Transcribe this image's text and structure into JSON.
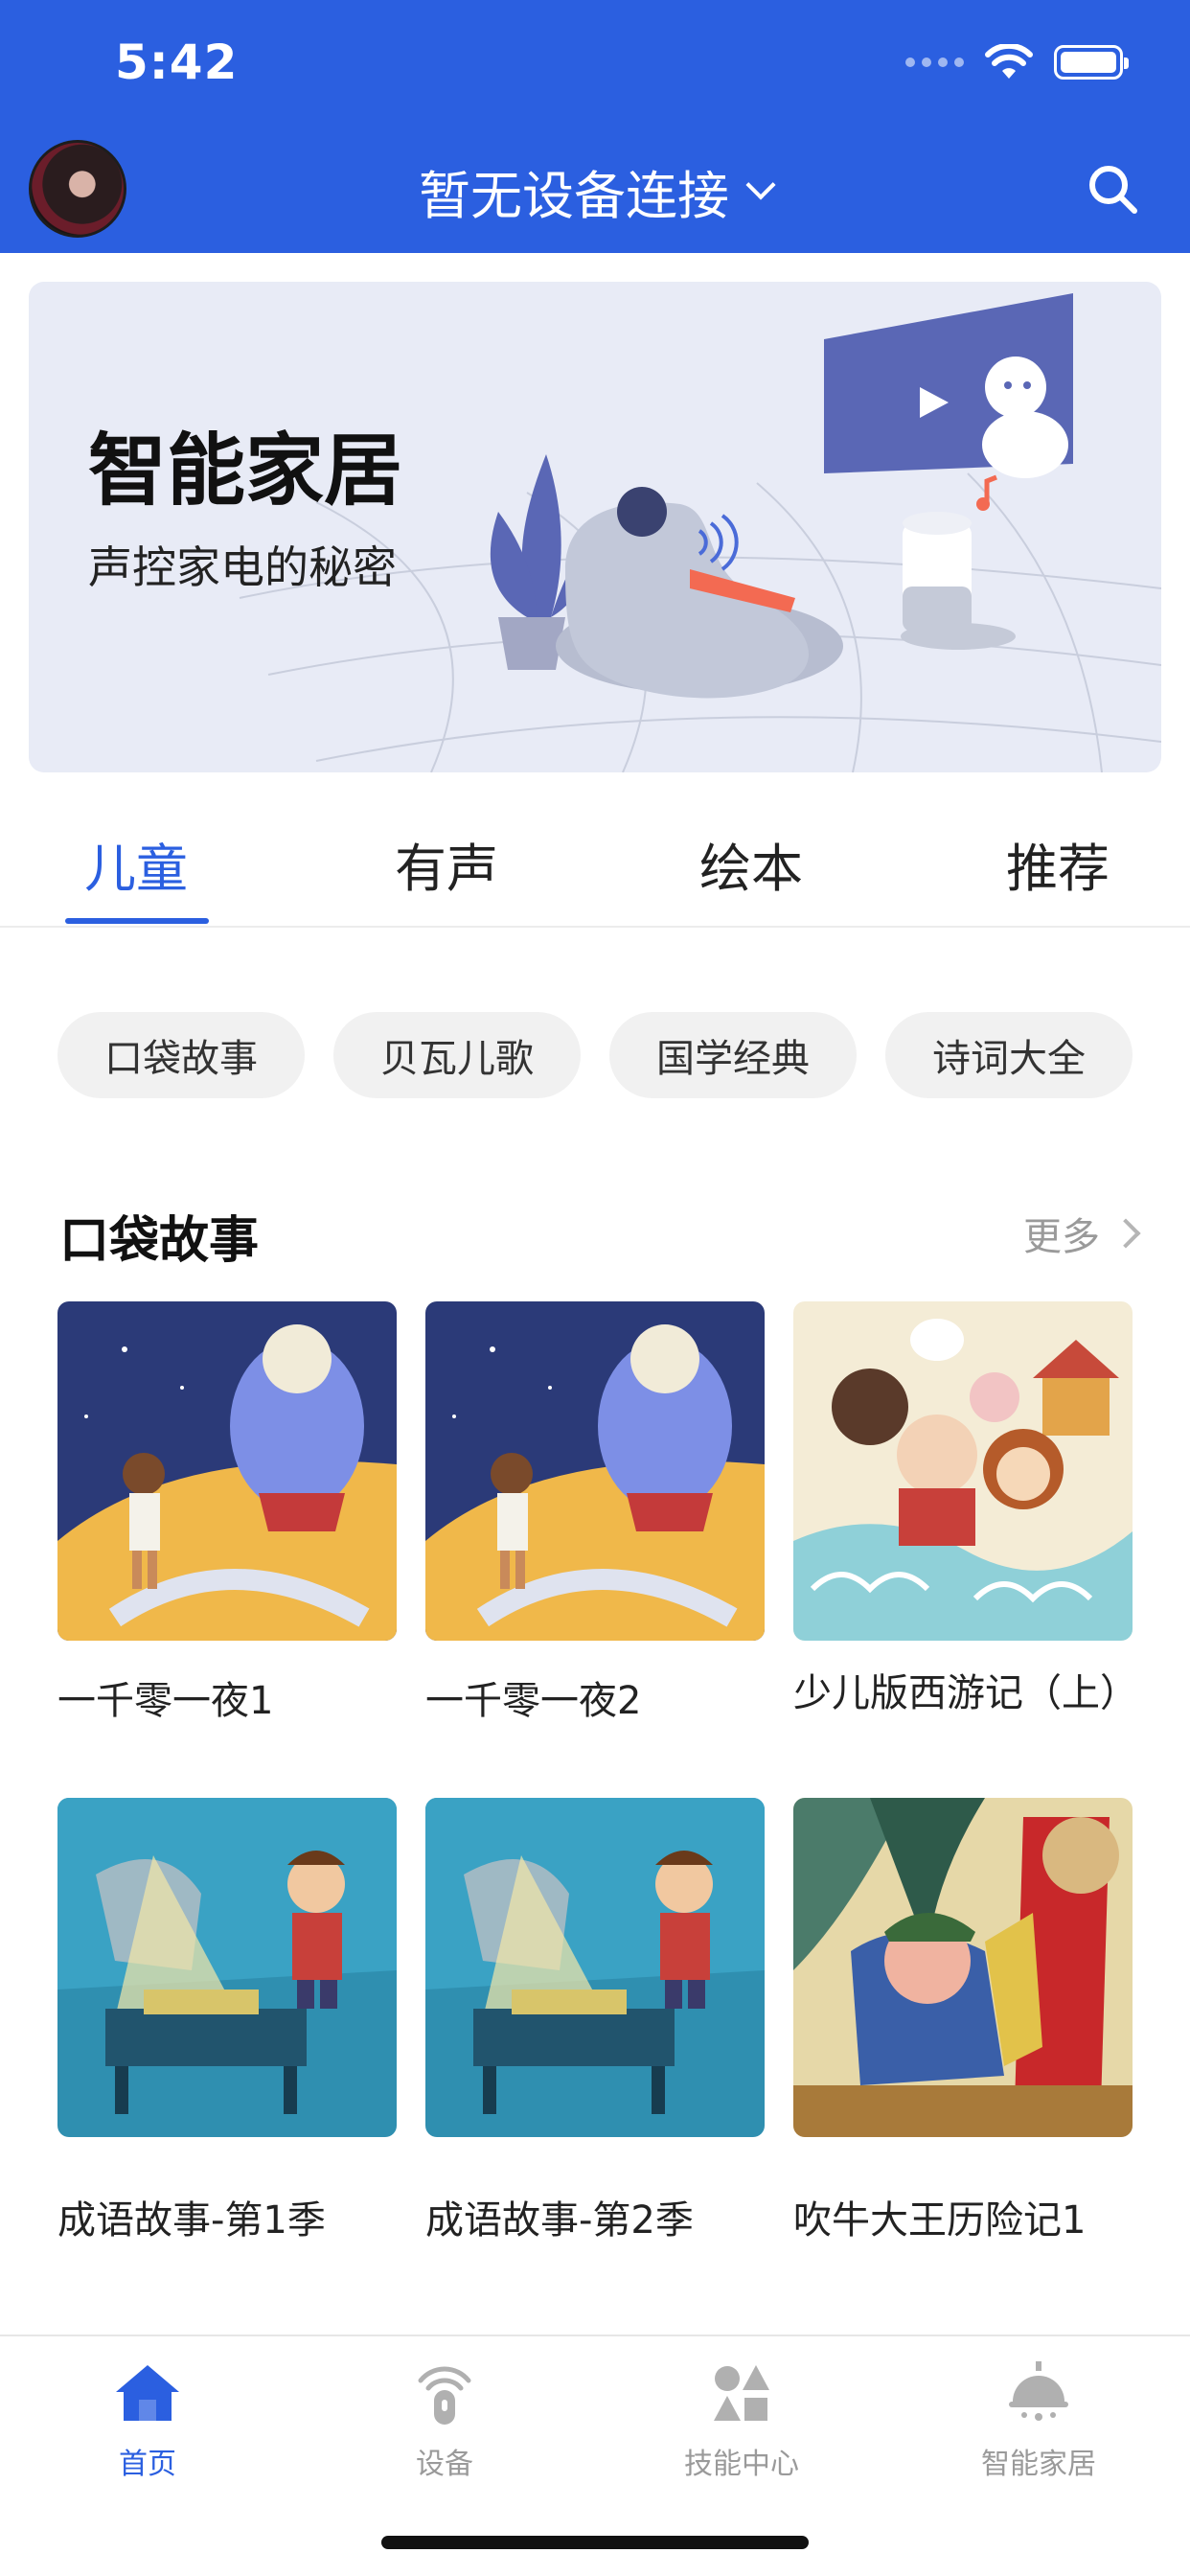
{
  "status_bar": {
    "time": "5:42"
  },
  "header": {
    "device_label": "暂无设备连接"
  },
  "banner": {
    "title": "智能家居",
    "subtitle": "声控家电的秘密"
  },
  "tabs": [
    {
      "label": "儿童",
      "active": true
    },
    {
      "label": "有声",
      "active": false
    },
    {
      "label": "绘本",
      "active": false
    },
    {
      "label": "推荐",
      "active": false
    }
  ],
  "chips": [
    "口袋故事",
    "贝瓦儿歌",
    "国学经典",
    "诗词大全"
  ],
  "section": {
    "title": "口袋故事",
    "more_label": "更多"
  },
  "cards": [
    {
      "title": "一千零一夜1"
    },
    {
      "title": "一千零一夜2"
    },
    {
      "title": "少儿版西游记（上）"
    },
    {
      "title": "成语故事-第1季"
    },
    {
      "title": "成语故事-第2季"
    },
    {
      "title": "吹牛大王历险记1"
    }
  ],
  "bottom_nav": [
    {
      "label": "首页",
      "icon": "home-icon",
      "active": true
    },
    {
      "label": "设备",
      "icon": "speaker-icon",
      "active": false
    },
    {
      "label": "技能中心",
      "icon": "shapes-icon",
      "active": false
    },
    {
      "label": "智能家居",
      "icon": "bell-icon",
      "active": false
    }
  ],
  "colors": {
    "accent": "#2b5fe0",
    "banner_bg": "#e8ebf6",
    "chip_bg": "#f1f1f1"
  }
}
